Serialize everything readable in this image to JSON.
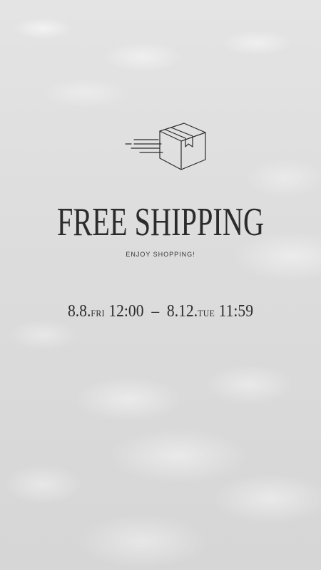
{
  "banner": {
    "title": "FREE SHIPPING",
    "subtitle": "ENJOY SHOPPING!",
    "start_date": "8.8.",
    "start_day": "FRI",
    "start_time": "12:00",
    "separator": "–",
    "end_date": "8.12.",
    "end_day": "TUE",
    "end_time": "11:59"
  },
  "icons": {
    "delivery": "fast-delivery-box-icon"
  },
  "colors": {
    "text": "#2b2b2b",
    "background": "#dcdcdc"
  }
}
